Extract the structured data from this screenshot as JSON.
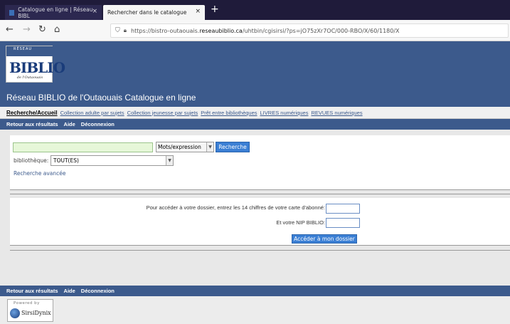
{
  "browser": {
    "tabs": [
      {
        "label": "Catalogue en ligne | Réseau BIBL"
      },
      {
        "label": "Rechercher dans le catalogue"
      }
    ],
    "new_tab": "+",
    "close_glyph": "×",
    "url_prefix": "https://bistro-outaouais.",
    "url_domain": "reseaubiblio.ca",
    "url_path": "/uhtbin/cgisirsi/?ps=jO75zXr7OC/000-RBO/X/60/1180/X"
  },
  "site": {
    "logo_top": "RÉSEAU",
    "logo_main": "BIBLIO",
    "logo_sub": "de l'Outaouais",
    "title": "Réseau BIBLIO de l'Outaouais Catalogue en ligne"
  },
  "nav_tabs": [
    "Recherche/Accueil",
    "Collection adulte par sujets",
    "Collection jeunesse par sujets",
    "Prêt entre bibliothèques",
    "LIVRES numériques",
    "REVUES numériques"
  ],
  "actions": {
    "back": "Retour aux résultats",
    "help": "Aide",
    "logout": "Déconnexion"
  },
  "search": {
    "query": "",
    "mode": "Mots/expression",
    "button": "Recherche",
    "library_label": "bibliothèque:",
    "library_value": "TOUT(ES)",
    "advanced": "Recherche avancée"
  },
  "login": {
    "card_label": "Pour accéder à votre dossier, entrez les 14 chiffres de votre carte d'abonné:",
    "pin_label": "Et votre NIP BIBLIO:",
    "button": "Accéder à mon dossier"
  },
  "footer": {
    "powered_by": "Powered by",
    "vendor": "SirsiDynix"
  },
  "colors": {
    "brand": "#3c5a8c",
    "button": "#3b7fd4"
  }
}
